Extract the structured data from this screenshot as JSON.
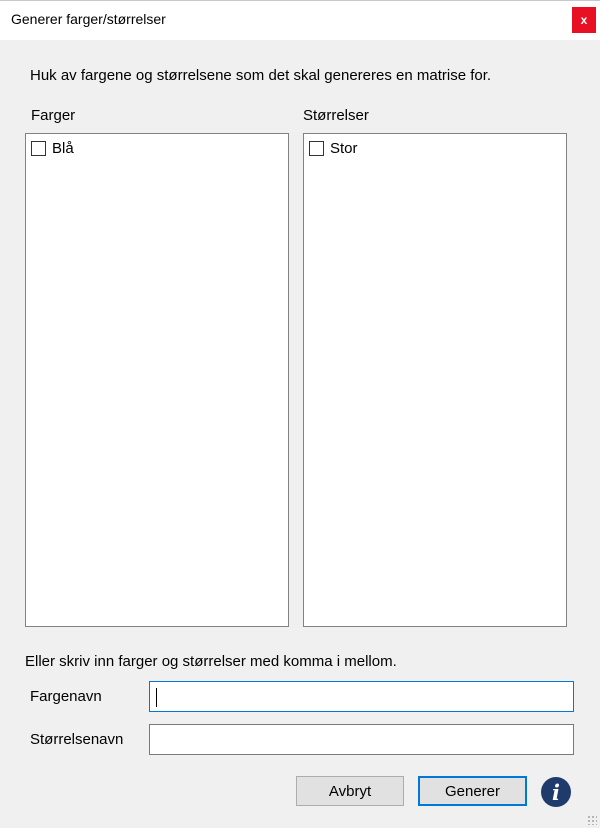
{
  "window": {
    "title": "Generer farger/størrelser",
    "close_glyph": "x"
  },
  "instruction": "Huk av fargene og størrelsene som det skal genereres en matrise for.",
  "colors_panel": {
    "label": "Farger",
    "items": [
      {
        "label": "Blå",
        "checked": false
      }
    ]
  },
  "sizes_panel": {
    "label": "Størrelser",
    "items": [
      {
        "label": "Stor",
        "checked": false
      }
    ]
  },
  "manual_entry_hint": "Eller skriv inn farger og størrelser med komma i mellom.",
  "fields": {
    "color_name": {
      "label": "Fargenavn",
      "value": "",
      "focused": true
    },
    "size_name": {
      "label": "Størrelsenavn",
      "value": ""
    }
  },
  "buttons": {
    "cancel": "Avbryt",
    "generate": "Generer",
    "info_glyph": "i"
  },
  "colors": {
    "accent": "#0078d7",
    "close_red": "#e81123",
    "info_icon_bg": "#1e3b6b"
  }
}
